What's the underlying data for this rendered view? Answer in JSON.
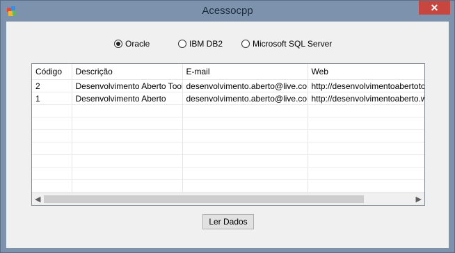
{
  "window": {
    "title": "Acessocpp",
    "close_label": "✕"
  },
  "database_options": [
    {
      "label": "Oracle",
      "checked": true
    },
    {
      "label": "IBM DB2",
      "checked": false
    },
    {
      "label": "Microsoft SQL Server",
      "checked": false
    }
  ],
  "grid": {
    "columns": [
      "Código",
      "Descrição",
      "E-mail",
      "Web"
    ],
    "rows": [
      [
        "2",
        "Desenvolvimento Aberto Tools",
        "desenvolvimento.aberto@live.com",
        "http://desenvolvimentoabertotools"
      ],
      [
        "1",
        "Desenvolvimento Aberto",
        "desenvolvimento.aberto@live.com",
        "http://desenvolvimentoaberto.wordpress.com"
      ]
    ]
  },
  "actions": {
    "read_button": "Ler Dados"
  },
  "colors": {
    "titlebar": "#7d93ad",
    "close": "#c7463f",
    "client": "#f0f0f0"
  },
  "icons": {
    "app": "app-icon",
    "close": "close-icon",
    "scroll_left": "scroll-left-icon",
    "scroll_right": "scroll-right-icon"
  }
}
